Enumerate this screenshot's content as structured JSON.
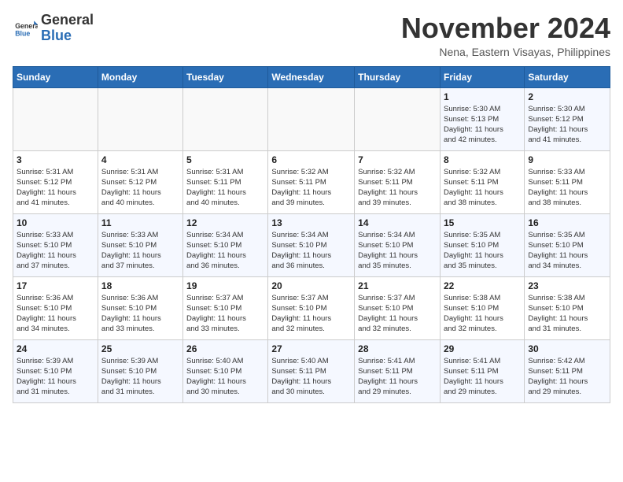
{
  "header": {
    "logo_general": "General",
    "logo_blue": "Blue",
    "month_title": "November 2024",
    "location": "Nena, Eastern Visayas, Philippines"
  },
  "weekdays": [
    "Sunday",
    "Monday",
    "Tuesday",
    "Wednesday",
    "Thursday",
    "Friday",
    "Saturday"
  ],
  "weeks": [
    [
      {
        "day": "",
        "info": ""
      },
      {
        "day": "",
        "info": ""
      },
      {
        "day": "",
        "info": ""
      },
      {
        "day": "",
        "info": ""
      },
      {
        "day": "",
        "info": ""
      },
      {
        "day": "1",
        "info": "Sunrise: 5:30 AM\nSunset: 5:13 PM\nDaylight: 11 hours\nand 42 minutes."
      },
      {
        "day": "2",
        "info": "Sunrise: 5:30 AM\nSunset: 5:12 PM\nDaylight: 11 hours\nand 41 minutes."
      }
    ],
    [
      {
        "day": "3",
        "info": "Sunrise: 5:31 AM\nSunset: 5:12 PM\nDaylight: 11 hours\nand 41 minutes."
      },
      {
        "day": "4",
        "info": "Sunrise: 5:31 AM\nSunset: 5:12 PM\nDaylight: 11 hours\nand 40 minutes."
      },
      {
        "day": "5",
        "info": "Sunrise: 5:31 AM\nSunset: 5:11 PM\nDaylight: 11 hours\nand 40 minutes."
      },
      {
        "day": "6",
        "info": "Sunrise: 5:32 AM\nSunset: 5:11 PM\nDaylight: 11 hours\nand 39 minutes."
      },
      {
        "day": "7",
        "info": "Sunrise: 5:32 AM\nSunset: 5:11 PM\nDaylight: 11 hours\nand 39 minutes."
      },
      {
        "day": "8",
        "info": "Sunrise: 5:32 AM\nSunset: 5:11 PM\nDaylight: 11 hours\nand 38 minutes."
      },
      {
        "day": "9",
        "info": "Sunrise: 5:33 AM\nSunset: 5:11 PM\nDaylight: 11 hours\nand 38 minutes."
      }
    ],
    [
      {
        "day": "10",
        "info": "Sunrise: 5:33 AM\nSunset: 5:10 PM\nDaylight: 11 hours\nand 37 minutes."
      },
      {
        "day": "11",
        "info": "Sunrise: 5:33 AM\nSunset: 5:10 PM\nDaylight: 11 hours\nand 37 minutes."
      },
      {
        "day": "12",
        "info": "Sunrise: 5:34 AM\nSunset: 5:10 PM\nDaylight: 11 hours\nand 36 minutes."
      },
      {
        "day": "13",
        "info": "Sunrise: 5:34 AM\nSunset: 5:10 PM\nDaylight: 11 hours\nand 36 minutes."
      },
      {
        "day": "14",
        "info": "Sunrise: 5:34 AM\nSunset: 5:10 PM\nDaylight: 11 hours\nand 35 minutes."
      },
      {
        "day": "15",
        "info": "Sunrise: 5:35 AM\nSunset: 5:10 PM\nDaylight: 11 hours\nand 35 minutes."
      },
      {
        "day": "16",
        "info": "Sunrise: 5:35 AM\nSunset: 5:10 PM\nDaylight: 11 hours\nand 34 minutes."
      }
    ],
    [
      {
        "day": "17",
        "info": "Sunrise: 5:36 AM\nSunset: 5:10 PM\nDaylight: 11 hours\nand 34 minutes."
      },
      {
        "day": "18",
        "info": "Sunrise: 5:36 AM\nSunset: 5:10 PM\nDaylight: 11 hours\nand 33 minutes."
      },
      {
        "day": "19",
        "info": "Sunrise: 5:37 AM\nSunset: 5:10 PM\nDaylight: 11 hours\nand 33 minutes."
      },
      {
        "day": "20",
        "info": "Sunrise: 5:37 AM\nSunset: 5:10 PM\nDaylight: 11 hours\nand 32 minutes."
      },
      {
        "day": "21",
        "info": "Sunrise: 5:37 AM\nSunset: 5:10 PM\nDaylight: 11 hours\nand 32 minutes."
      },
      {
        "day": "22",
        "info": "Sunrise: 5:38 AM\nSunset: 5:10 PM\nDaylight: 11 hours\nand 32 minutes."
      },
      {
        "day": "23",
        "info": "Sunrise: 5:38 AM\nSunset: 5:10 PM\nDaylight: 11 hours\nand 31 minutes."
      }
    ],
    [
      {
        "day": "24",
        "info": "Sunrise: 5:39 AM\nSunset: 5:10 PM\nDaylight: 11 hours\nand 31 minutes."
      },
      {
        "day": "25",
        "info": "Sunrise: 5:39 AM\nSunset: 5:10 PM\nDaylight: 11 hours\nand 31 minutes."
      },
      {
        "day": "26",
        "info": "Sunrise: 5:40 AM\nSunset: 5:10 PM\nDaylight: 11 hours\nand 30 minutes."
      },
      {
        "day": "27",
        "info": "Sunrise: 5:40 AM\nSunset: 5:11 PM\nDaylight: 11 hours\nand 30 minutes."
      },
      {
        "day": "28",
        "info": "Sunrise: 5:41 AM\nSunset: 5:11 PM\nDaylight: 11 hours\nand 29 minutes."
      },
      {
        "day": "29",
        "info": "Sunrise: 5:41 AM\nSunset: 5:11 PM\nDaylight: 11 hours\nand 29 minutes."
      },
      {
        "day": "30",
        "info": "Sunrise: 5:42 AM\nSunset: 5:11 PM\nDaylight: 11 hours\nand 29 minutes."
      }
    ]
  ]
}
